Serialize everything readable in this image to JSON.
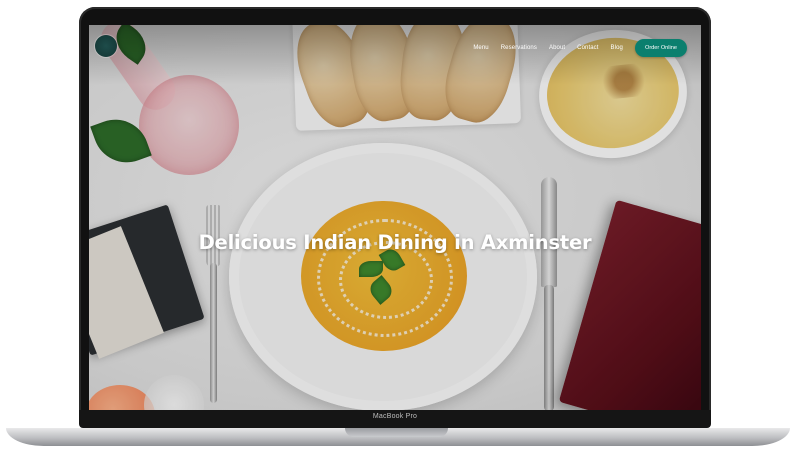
{
  "device": {
    "label": "MacBook Pro"
  },
  "site": {
    "nav": {
      "items": [
        {
          "label": "Menu"
        },
        {
          "label": "Reservations"
        },
        {
          "label": "About"
        },
        {
          "label": "Contact"
        },
        {
          "label": "Blog"
        }
      ],
      "cta_label": "Order Online"
    },
    "hero": {
      "title": "Delicious Indian Dining in Axminster"
    }
  },
  "colors": {
    "cta_background": "#0b7f6e",
    "hero_text": "#ffffff"
  }
}
